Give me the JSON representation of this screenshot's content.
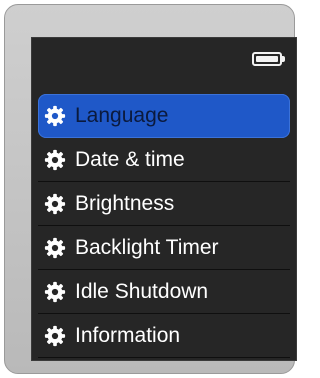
{
  "colors": {
    "screen_background": "#262626",
    "selected_item": "#1f58c8",
    "text": "#ffffff",
    "selected_text": "#0b1a3d"
  },
  "status_bar": {
    "battery_icon": "battery-icon",
    "battery_level": 1.0
  },
  "menu": {
    "items": [
      {
        "label": "Language",
        "icon": "gear-icon",
        "selected": true
      },
      {
        "label": "Date & time",
        "icon": "gear-icon",
        "selected": false
      },
      {
        "label": "Brightness",
        "icon": "gear-icon",
        "selected": false
      },
      {
        "label": "Backlight Timer",
        "icon": "gear-icon",
        "selected": false
      },
      {
        "label": "Idle Shutdown",
        "icon": "gear-icon",
        "selected": false
      },
      {
        "label": "Information",
        "icon": "gear-icon",
        "selected": false
      }
    ]
  }
}
